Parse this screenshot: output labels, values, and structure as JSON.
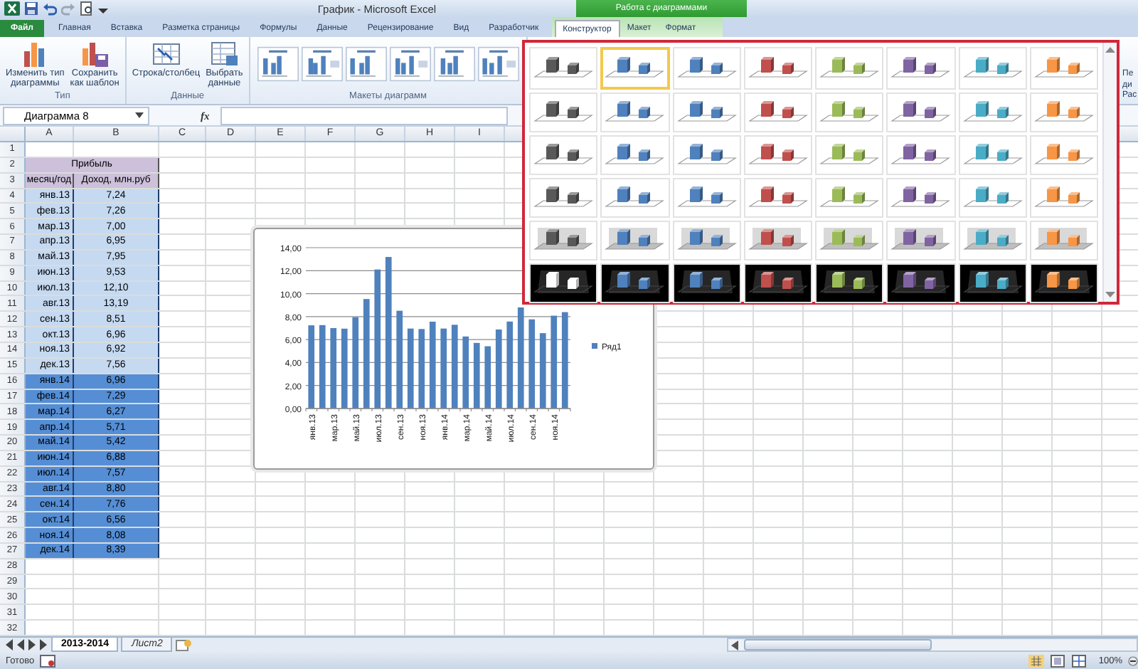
{
  "window": {
    "title": "График - Microsoft Excel"
  },
  "context_tab_header": "Работа с диаграммами",
  "tabs": [
    {
      "label": "Файл",
      "kind": "file",
      "selected": false
    },
    {
      "label": "Главная",
      "kind": "normal",
      "selected": false
    },
    {
      "label": "Вставка",
      "kind": "normal",
      "selected": false
    },
    {
      "label": "Разметка страницы",
      "kind": "normal",
      "selected": false
    },
    {
      "label": "Формулы",
      "kind": "normal",
      "selected": false
    },
    {
      "label": "Данные",
      "kind": "normal",
      "selected": false
    },
    {
      "label": "Рецензирование",
      "kind": "normal",
      "selected": false
    },
    {
      "label": "Вид",
      "kind": "normal",
      "selected": false
    },
    {
      "label": "Разработчик",
      "kind": "normal",
      "selected": false
    },
    {
      "label": "Конструктор",
      "kind": "context",
      "selected": true
    },
    {
      "label": "Макет",
      "kind": "context",
      "selected": false
    },
    {
      "label": "Формат",
      "kind": "context",
      "selected": false
    }
  ],
  "ribbon": {
    "groups": [
      {
        "label": "Тип",
        "kind": "buttons",
        "buttons": [
          {
            "label": "Изменить тип\nдиаграммы"
          },
          {
            "label": "Сохранить\nкак шаблон"
          }
        ]
      },
      {
        "label": "Данные",
        "kind": "buttons",
        "buttons": [
          {
            "label": "Строка/столбец"
          },
          {
            "label": "Выбрать\nданные"
          }
        ]
      },
      {
        "label": "Макеты диаграмм",
        "kind": "layouts"
      }
    ],
    "cut_texts": [
      "Пе",
      "ди",
      "Рас"
    ]
  },
  "formula_bar": {
    "name_box": "Диаграмма 8",
    "function_button": "fx"
  },
  "column_letters": [
    "A",
    "B",
    "C",
    "D",
    "E",
    "F",
    "G",
    "H",
    "I"
  ],
  "row_numbers": [
    "1",
    "2",
    "3",
    "4",
    "5",
    "6",
    "7",
    "8",
    "9",
    "10",
    "11",
    "12",
    "13",
    "14",
    "15",
    "16",
    "17",
    "18",
    "19",
    "20",
    "21",
    "22",
    "23",
    "24",
    "25",
    "26",
    "27",
    "28",
    "29",
    "30",
    "31",
    "32"
  ],
  "table": {
    "title": "Прибыль",
    "columns": [
      "месяц/год",
      "Доход, млн.руб"
    ],
    "rows": [
      {
        "month": "янв.13",
        "income": "7,24",
        "color": "#c5d9f1"
      },
      {
        "month": "фев.13",
        "income": "7,26",
        "color": "#c5d9f1"
      },
      {
        "month": "мар.13",
        "income": "7,00",
        "color": "#c5d9f1"
      },
      {
        "month": "апр.13",
        "income": "6,95",
        "color": "#c5d9f1"
      },
      {
        "month": "май.13",
        "income": "7,95",
        "color": "#c5d9f1"
      },
      {
        "month": "июн.13",
        "income": "9,53",
        "color": "#c5d9f1"
      },
      {
        "month": "июл.13",
        "income": "12,10",
        "color": "#c5d9f1"
      },
      {
        "month": "авг.13",
        "income": "13,19",
        "color": "#c5d9f1"
      },
      {
        "month": "сен.13",
        "income": "8,51",
        "color": "#c5d9f1"
      },
      {
        "month": "окт.13",
        "income": "6,96",
        "color": "#c5d9f1"
      },
      {
        "month": "ноя.13",
        "income": "6,92",
        "color": "#c5d9f1"
      },
      {
        "month": "дек.13",
        "income": "7,56",
        "color": "#c5d9f1"
      },
      {
        "month": "янв.14",
        "income": "6,96",
        "color": "#558ed5"
      },
      {
        "month": "фев.14",
        "income": "7,29",
        "color": "#558ed5"
      },
      {
        "month": "мар.14",
        "income": "6,27",
        "color": "#558ed5"
      },
      {
        "month": "апр.14",
        "income": "5,71",
        "color": "#558ed5"
      },
      {
        "month": "май.14",
        "income": "5,42",
        "color": "#558ed5"
      },
      {
        "month": "июн.14",
        "income": "6,88",
        "color": "#558ed5"
      },
      {
        "month": "июл.14",
        "income": "7,57",
        "color": "#558ed5"
      },
      {
        "month": "авг.14",
        "income": "8,80",
        "color": "#558ed5"
      },
      {
        "month": "сен.14",
        "income": "7,76",
        "color": "#558ed5"
      },
      {
        "month": "окт.14",
        "income": "6,56",
        "color": "#558ed5"
      },
      {
        "month": "ноя.14",
        "income": "8,08",
        "color": "#558ed5"
      },
      {
        "month": "дек.14",
        "income": "8,39",
        "color": "#558ed5"
      }
    ]
  },
  "chart": {
    "chart_data": {
      "type": "bar",
      "series": [
        {
          "name": "Ряд1",
          "color": "#4f81bd",
          "values": [
            7.24,
            7.26,
            7.0,
            6.95,
            7.95,
            9.53,
            12.1,
            13.19,
            8.51,
            6.96,
            6.92,
            7.56,
            6.96,
            7.29,
            6.27,
            5.71,
            5.42,
            6.88,
            7.57,
            8.8,
            7.76,
            6.56,
            8.08,
            8.39
          ]
        }
      ],
      "ylim": [
        0,
        14
      ],
      "yticks": [
        {
          "value": 0,
          "label": "0,00"
        },
        {
          "value": 2,
          "label": "2,00"
        },
        {
          "value": 4,
          "label": "4,00"
        },
        {
          "value": 6,
          "label": "6,00"
        },
        {
          "value": 8,
          "label": "8,00"
        },
        {
          "value": 10,
          "label": "10,00"
        },
        {
          "value": 12,
          "label": "12,00"
        },
        {
          "value": 14,
          "label": "14,00"
        }
      ],
      "grid": true,
      "categories": [
        "янв.13",
        null,
        "мар.13",
        null,
        "май.13",
        null,
        "июл.13",
        null,
        "сен.13",
        null,
        "ноя.13",
        null,
        "янв.14",
        null,
        "мар.14",
        null,
        "май.14",
        null,
        "июл.14",
        null,
        "сен.14",
        null,
        "ноя.14",
        null
      ]
    }
  },
  "style_gallery": {
    "rows": [
      {
        "kind": "plain",
        "items": [
          {
            "color": "#595959",
            "selected": false
          },
          {
            "color": "#4f81bd",
            "selected": true
          },
          {
            "color": "#4f81bd",
            "selected": false
          },
          {
            "color": "#c0504d",
            "selected": false
          },
          {
            "color": "#9bbb59",
            "selected": false
          },
          {
            "color": "#8064a2",
            "selected": false
          },
          {
            "color": "#4bacc6",
            "selected": false
          },
          {
            "color": "#f79646",
            "selected": false
          }
        ]
      },
      {
        "kind": "plain",
        "items": [
          {
            "color": "#595959",
            "selected": false
          },
          {
            "color": "#4f81bd",
            "selected": false
          },
          {
            "color": "#4f81bd",
            "selected": false
          },
          {
            "color": "#c0504d",
            "selected": false
          },
          {
            "color": "#9bbb59",
            "selected": false
          },
          {
            "color": "#8064a2",
            "selected": false
          },
          {
            "color": "#4bacc6",
            "selected": false
          },
          {
            "color": "#f79646",
            "selected": false
          }
        ]
      },
      {
        "kind": "plain",
        "items": [
          {
            "color": "#595959",
            "selected": false
          },
          {
            "color": "#4f81bd",
            "selected": false
          },
          {
            "color": "#4f81bd",
            "selected": false
          },
          {
            "color": "#c0504d",
            "selected": false
          },
          {
            "color": "#9bbb59",
            "selected": false
          },
          {
            "color": "#8064a2",
            "selected": false
          },
          {
            "color": "#4bacc6",
            "selected": false
          },
          {
            "color": "#f79646",
            "selected": false
          }
        ]
      },
      {
        "kind": "plain",
        "items": [
          {
            "color": "#595959",
            "selected": false
          },
          {
            "color": "#4f81bd",
            "selected": false
          },
          {
            "color": "#4f81bd",
            "selected": false
          },
          {
            "color": "#c0504d",
            "selected": false
          },
          {
            "color": "#9bbb59",
            "selected": false
          },
          {
            "color": "#8064a2",
            "selected": false
          },
          {
            "color": "#4bacc6",
            "selected": false
          },
          {
            "color": "#f79646",
            "selected": false
          }
        ]
      },
      {
        "kind": "shaded",
        "items": [
          {
            "color": "#595959",
            "selected": false
          },
          {
            "color": "#4f81bd",
            "selected": false
          },
          {
            "color": "#4f81bd",
            "selected": false
          },
          {
            "color": "#c0504d",
            "selected": false
          },
          {
            "color": "#9bbb59",
            "selected": false
          },
          {
            "color": "#8064a2",
            "selected": false
          },
          {
            "color": "#4bacc6",
            "selected": false
          },
          {
            "color": "#f79646",
            "selected": false
          }
        ]
      },
      {
        "kind": "dark",
        "items": [
          {
            "color": "#ffffff",
            "selected": false
          },
          {
            "color": "#4f81bd",
            "selected": false
          },
          {
            "color": "#4f81bd",
            "selected": false
          },
          {
            "color": "#c0504d",
            "selected": false
          },
          {
            "color": "#9bbb59",
            "selected": false
          },
          {
            "color": "#8064a2",
            "selected": false
          },
          {
            "color": "#4bacc6",
            "selected": false
          },
          {
            "color": "#f79646",
            "selected": false
          }
        ]
      }
    ]
  },
  "sheet_tabs": [
    {
      "label": "2013-2014",
      "selected": true
    },
    {
      "label": "Лист2",
      "selected": false
    }
  ],
  "status_bar": {
    "status": "Готово",
    "zoom": "100%"
  }
}
